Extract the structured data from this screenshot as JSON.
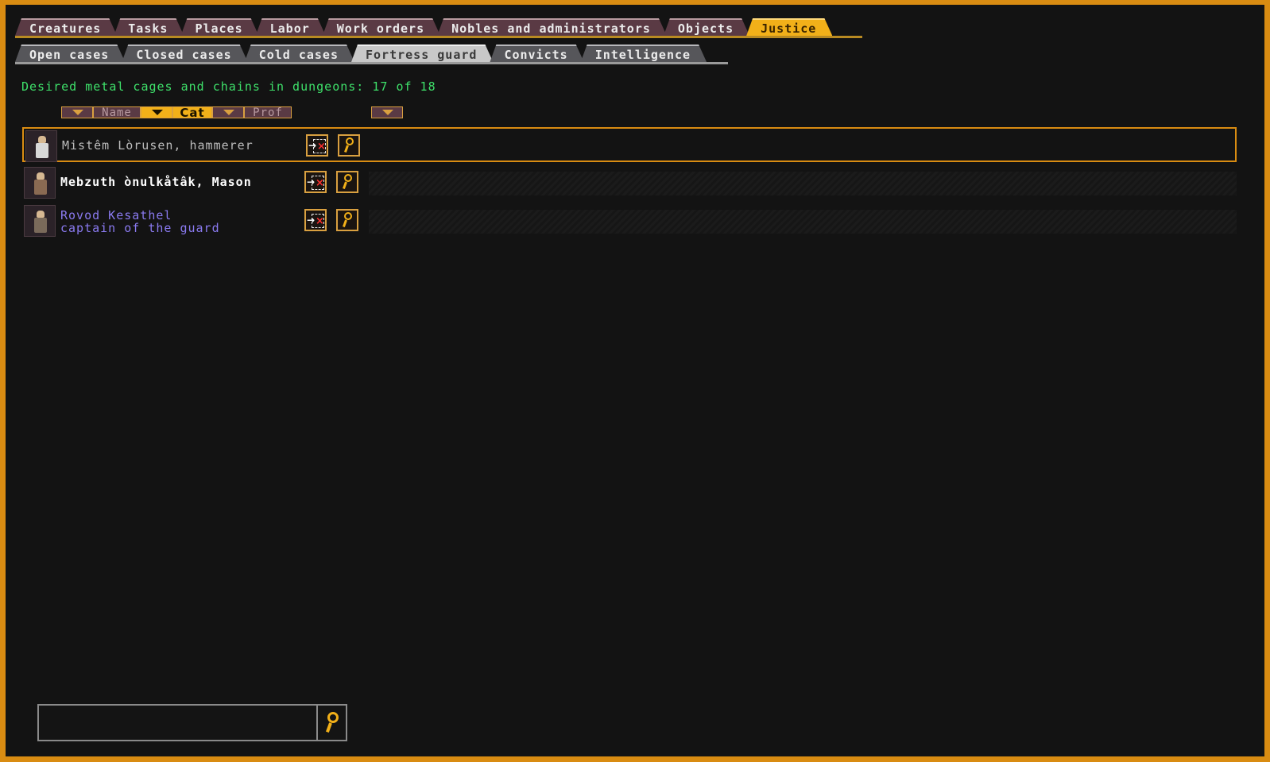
{
  "top_tabs": [
    {
      "label": "Creatures",
      "active": false
    },
    {
      "label": "Tasks",
      "active": false
    },
    {
      "label": "Places",
      "active": false
    },
    {
      "label": "Labor",
      "active": false
    },
    {
      "label": "Work orders",
      "active": false
    },
    {
      "label": "Nobles and administrators",
      "active": false
    },
    {
      "label": "Objects",
      "active": false
    },
    {
      "label": "Justice",
      "active": true
    }
  ],
  "sub_tabs": [
    {
      "label": "Open cases",
      "active": false
    },
    {
      "label": "Closed cases",
      "active": false
    },
    {
      "label": "Cold cases",
      "active": false
    },
    {
      "label": "Fortress guard",
      "active": true
    },
    {
      "label": "Convicts",
      "active": false
    },
    {
      "label": "Intelligence",
      "active": false
    }
  ],
  "status_text": "Desired metal cages and chains in dungeons: 17 of 18",
  "sort_bar": {
    "name_label": "Name",
    "cat_label": "Cat",
    "prof_label": "Prof",
    "active": "Cat"
  },
  "guards": [
    {
      "line1": "Mistêm Lòrusen, hammerer",
      "line2": "",
      "color": "#bdbdbd",
      "selected": true
    },
    {
      "line1": "Mebzuth ònulkåtâk, Mason",
      "line2": "",
      "color": "#ffffff",
      "selected": false
    },
    {
      "line1": "Rovod Kesathel",
      "line2": "captain of the guard",
      "color": "#8a7af0",
      "selected": false
    }
  ],
  "colors": {
    "frame": "#d98c12",
    "accent": "#f2b019",
    "status_green": "#3ee06a",
    "background": "#131313"
  },
  "icons": {
    "remove": "remove-from-guard-icon",
    "view": "magnifier-icon",
    "search": "magnifier-icon"
  },
  "search": {
    "value": "",
    "placeholder": ""
  }
}
